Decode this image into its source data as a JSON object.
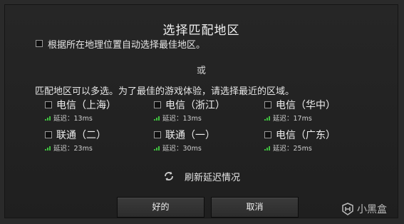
{
  "dialog": {
    "title": "选择匹配地区",
    "auto_select_label": "根据所在地理位置自动选择最佳地区。",
    "or_label": "或",
    "description": "匹配地区可以多选。为了最佳的游戏体验，请选择最近的区域。",
    "regions": [
      {
        "name": "电信（上海）",
        "latency": "延迟：13ms"
      },
      {
        "name": "电信（浙江）",
        "latency": "延迟：13ms"
      },
      {
        "name": "电信（华中）",
        "latency": "延迟：17ms"
      },
      {
        "name": "联通（二）",
        "latency": "延迟：23ms"
      },
      {
        "name": "联通（一）",
        "latency": "延迟：30ms"
      },
      {
        "name": "电信（广东）",
        "latency": "延迟：25ms"
      }
    ],
    "refresh_label": "刷新延迟情况",
    "ok_label": "好的",
    "cancel_label": "取消"
  },
  "watermark": {
    "text": "小黑盒"
  },
  "colors": {
    "signal": "#3fbf3f",
    "background": "#262626"
  }
}
